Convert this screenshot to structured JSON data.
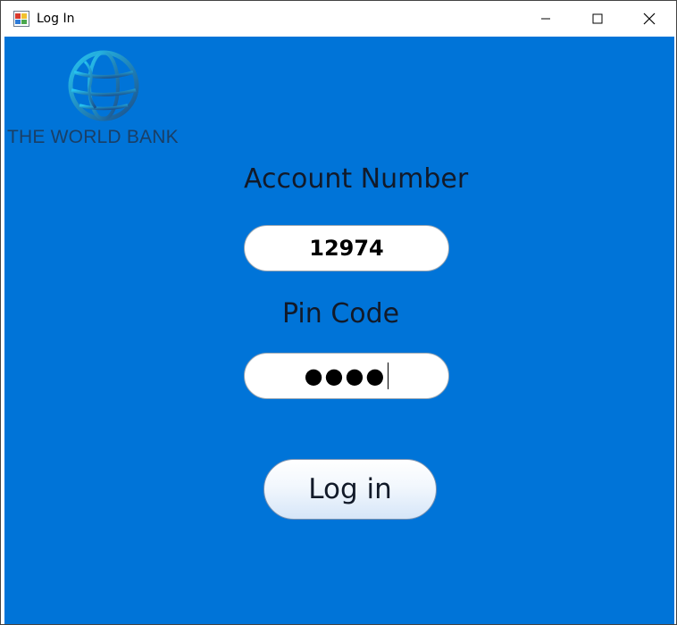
{
  "window": {
    "title": "Log In",
    "icon": "winforms-app-icon",
    "controls": [
      "minimize-icon",
      "maximize-icon",
      "close-icon"
    ]
  },
  "branding": {
    "logo_icon": "globe-icon",
    "logo_text": "THE WORLD BANK"
  },
  "form": {
    "account_label": "Account Number",
    "account_value": "12974",
    "pin_label": "Pin Code",
    "pin_value_masked": "●●●●",
    "login_label": "Log in"
  },
  "colors": {
    "background": "#0074d8",
    "logo_text": "#1a3f66",
    "field_bg": "#ffffff",
    "label_text": "#121a29"
  }
}
